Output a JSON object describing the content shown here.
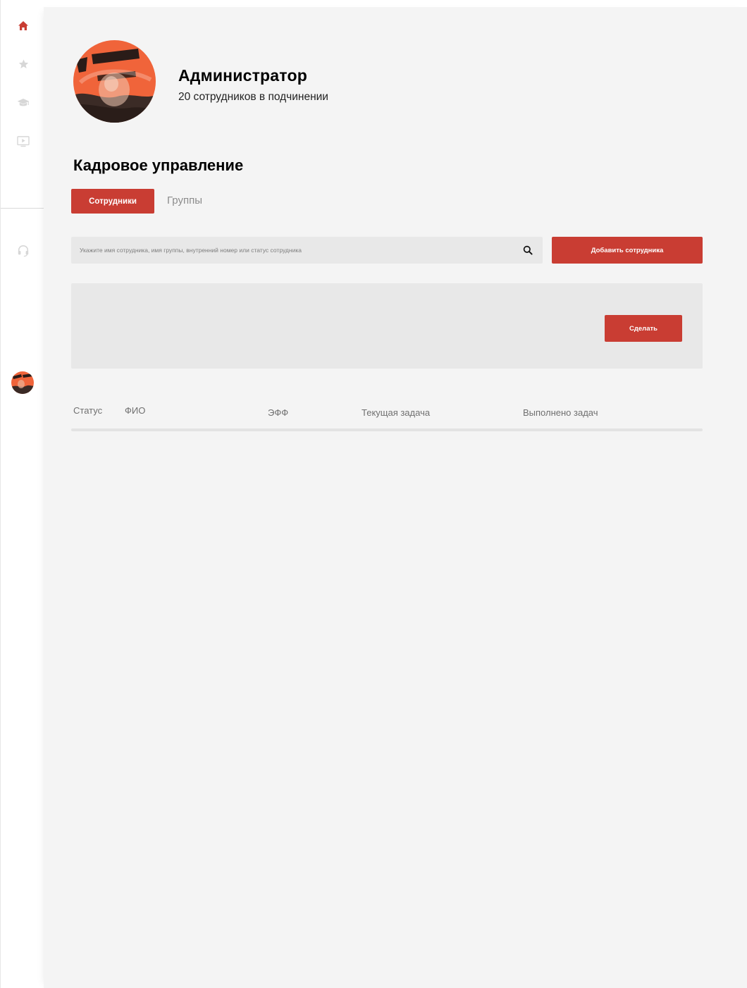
{
  "sidebar": {
    "icons": [
      "home-icon",
      "star-icon",
      "graduation-cap-icon",
      "video-play-icon",
      "headset-icon"
    ],
    "active_color": "#c93d33",
    "inactive_color": "#d7d7d7"
  },
  "profile": {
    "name": "Администратор",
    "subtitle": "20 сотрудников в подчинении"
  },
  "section": {
    "title": "Кадровое управление"
  },
  "tabs": [
    {
      "label": "Сотрудники",
      "active": true
    },
    {
      "label": "Группы",
      "active": false
    }
  ],
  "search": {
    "placeholder": "Укажите имя сотрудника, имя группы, внутренний номер или статус сотрудника"
  },
  "buttons": {
    "add_employee": "Добавить сотрудника",
    "do": "Сделать"
  },
  "table": {
    "columns": [
      "Статус",
      "ФИО",
      "ЭФФ",
      "Текущая задача",
      "Выполнено задач"
    ],
    "rows": []
  },
  "colors": {
    "accent": "#c93d33",
    "panel_background": "#f4f4f4",
    "field_background": "#e8e8e8"
  }
}
